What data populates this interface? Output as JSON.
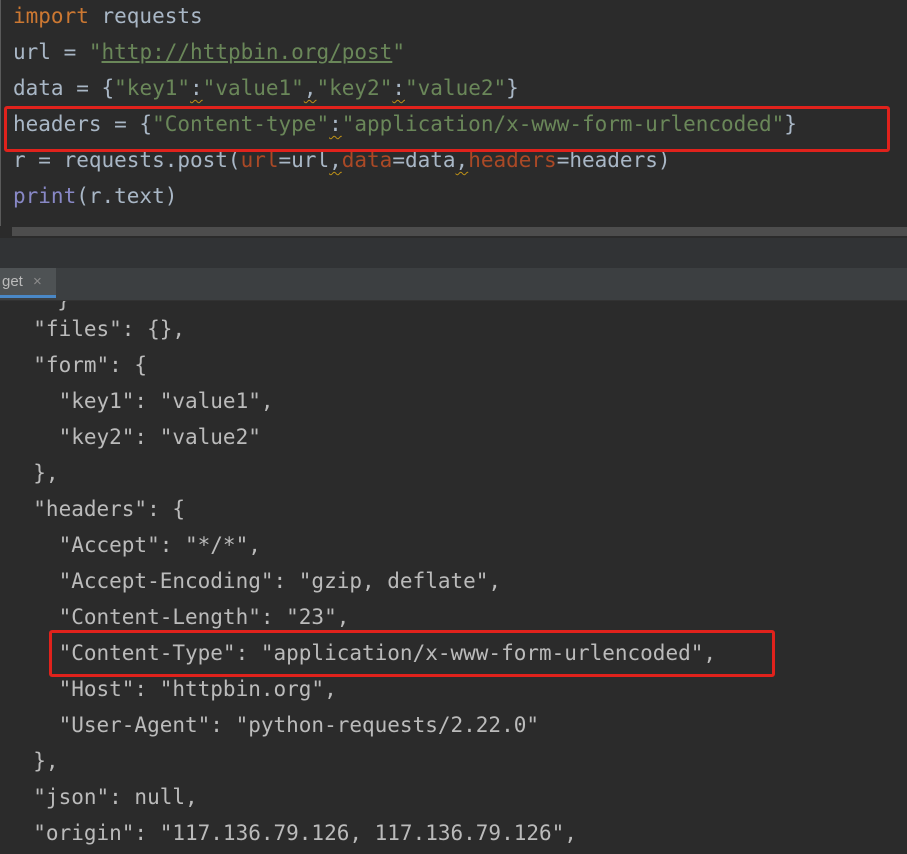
{
  "editor": {
    "lines": {
      "l1": {
        "kw": "import",
        "rest": " requests"
      },
      "l2": {
        "a": "url = ",
        "q1": "\"",
        "url": "http://httpbin.org/post",
        "q2": "\""
      },
      "l3": {
        "a": "data = {",
        "k1": "\"key1\"",
        "c1": ":",
        "v1": "\"value1\"",
        "s1": ",",
        "k2": "\"key2\"",
        "c2": ":",
        "v2": "\"value2\"",
        "b": "}"
      },
      "l4": {
        "a": "headers = {",
        "k": "\"Content-type\"",
        "c": ":",
        "v": "\"application/x-www-form-urlencoded\"",
        "b": "}"
      },
      "l5": {
        "a": "r = requests.post(",
        "p1": "url",
        "e1": "=url",
        "s1": ",",
        "p2": "data",
        "e2": "=data",
        "s2": ",",
        "p3": "headers",
        "e3": "=headers)"
      },
      "l6": {
        "fn": "print",
        "rest": "(r.text)"
      }
    }
  },
  "run_tab": {
    "label": "get",
    "close_glyph": "×"
  },
  "console": {
    "lines": [
      "  }",
      "  \"files\": {},",
      "  \"form\": {",
      "    \"key1\": \"value1\",",
      "    \"key2\": \"value2\"",
      "  },",
      "  \"headers\": {",
      "    \"Accept\": \"*/*\",",
      "    \"Accept-Encoding\": \"gzip, deflate\",",
      "    \"Content-Length\": \"23\",",
      "    \"Content-Type\": \"application/x-www-form-urlencoded\",",
      "    \"Host\": \"httpbin.org\",",
      "    \"User-Agent\": \"python-requests/2.22.0\"",
      "  },",
      "  \"json\": null,",
      "  \"origin\": \"117.136.79.126, 117.136.79.126\","
    ]
  },
  "colors": {
    "keyword": "#cc7832",
    "string": "#6a8759",
    "param": "#aa4926",
    "builtin": "#8888c6",
    "text": "#a9b7c6",
    "highlight": "#e0221c",
    "background": "#2b2b2b"
  }
}
